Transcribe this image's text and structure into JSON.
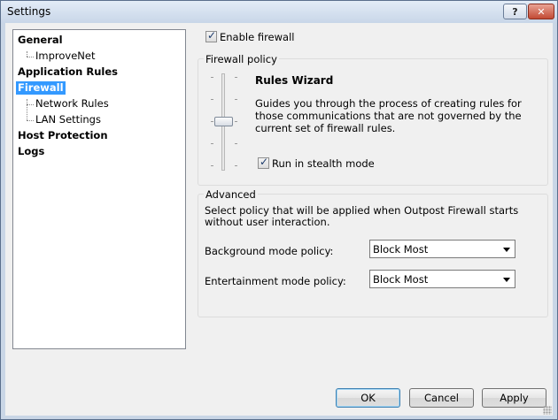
{
  "window": {
    "title": "Settings",
    "help_label": "?",
    "close_label": "✕"
  },
  "tree": {
    "items": [
      {
        "label": "General"
      },
      {
        "label": "ImproveNet"
      },
      {
        "label": "Application Rules"
      },
      {
        "label": "Firewall",
        "selected": true
      },
      {
        "label": "Network Rules"
      },
      {
        "label": "LAN Settings"
      },
      {
        "label": "Host Protection"
      },
      {
        "label": "Logs"
      }
    ]
  },
  "firewall": {
    "enable_label": "Enable firewall",
    "enable_checked": true
  },
  "policy": {
    "group_title": "Firewall policy",
    "wizard_title": "Rules Wizard",
    "wizard_description": "Guides you through the process of creating rules for those communications that are not governed by the current set of firewall rules.",
    "stealth_label": "Run in stealth mode",
    "stealth_checked": true,
    "slider_level": "3 of 5"
  },
  "advanced": {
    "group_title": "Advanced",
    "description": "Select policy that will be applied when Outpost Firewall starts without user interaction.",
    "background_label": "Background mode policy:",
    "background_value": "Block Most",
    "entertainment_label": "Entertainment mode policy:",
    "entertainment_value": "Block Most"
  },
  "buttons": {
    "ok": "OK",
    "cancel": "Cancel",
    "apply": "Apply"
  }
}
